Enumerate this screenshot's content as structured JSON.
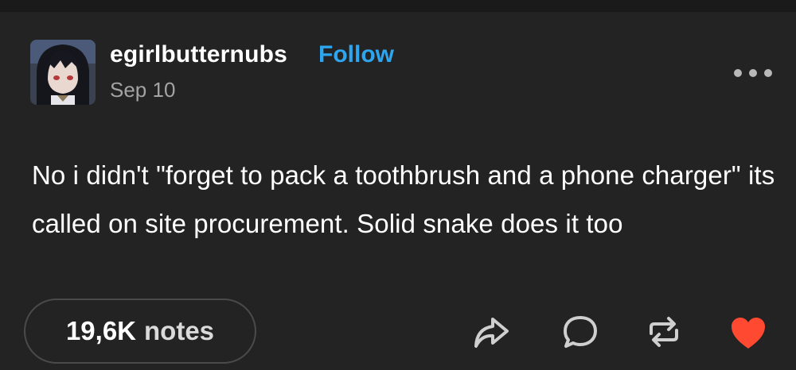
{
  "post": {
    "username": "egirlbutternubs",
    "follow_label": "Follow",
    "date": "Sep 10",
    "text": "No i didn't \"forget to pack a toothbrush and a phone charger\" its called on site procurement. Solid snake does it too",
    "notes_count": "19,6K",
    "notes_label": "notes"
  },
  "icons": {
    "more": "more-icon",
    "share": "share-icon",
    "reply": "reply-icon",
    "reblog": "reblog-icon",
    "like": "heart-icon"
  },
  "colors": {
    "background": "#232323",
    "follow": "#2ea6ef",
    "like": "#ff4930",
    "muted": "#a3a3a3"
  }
}
